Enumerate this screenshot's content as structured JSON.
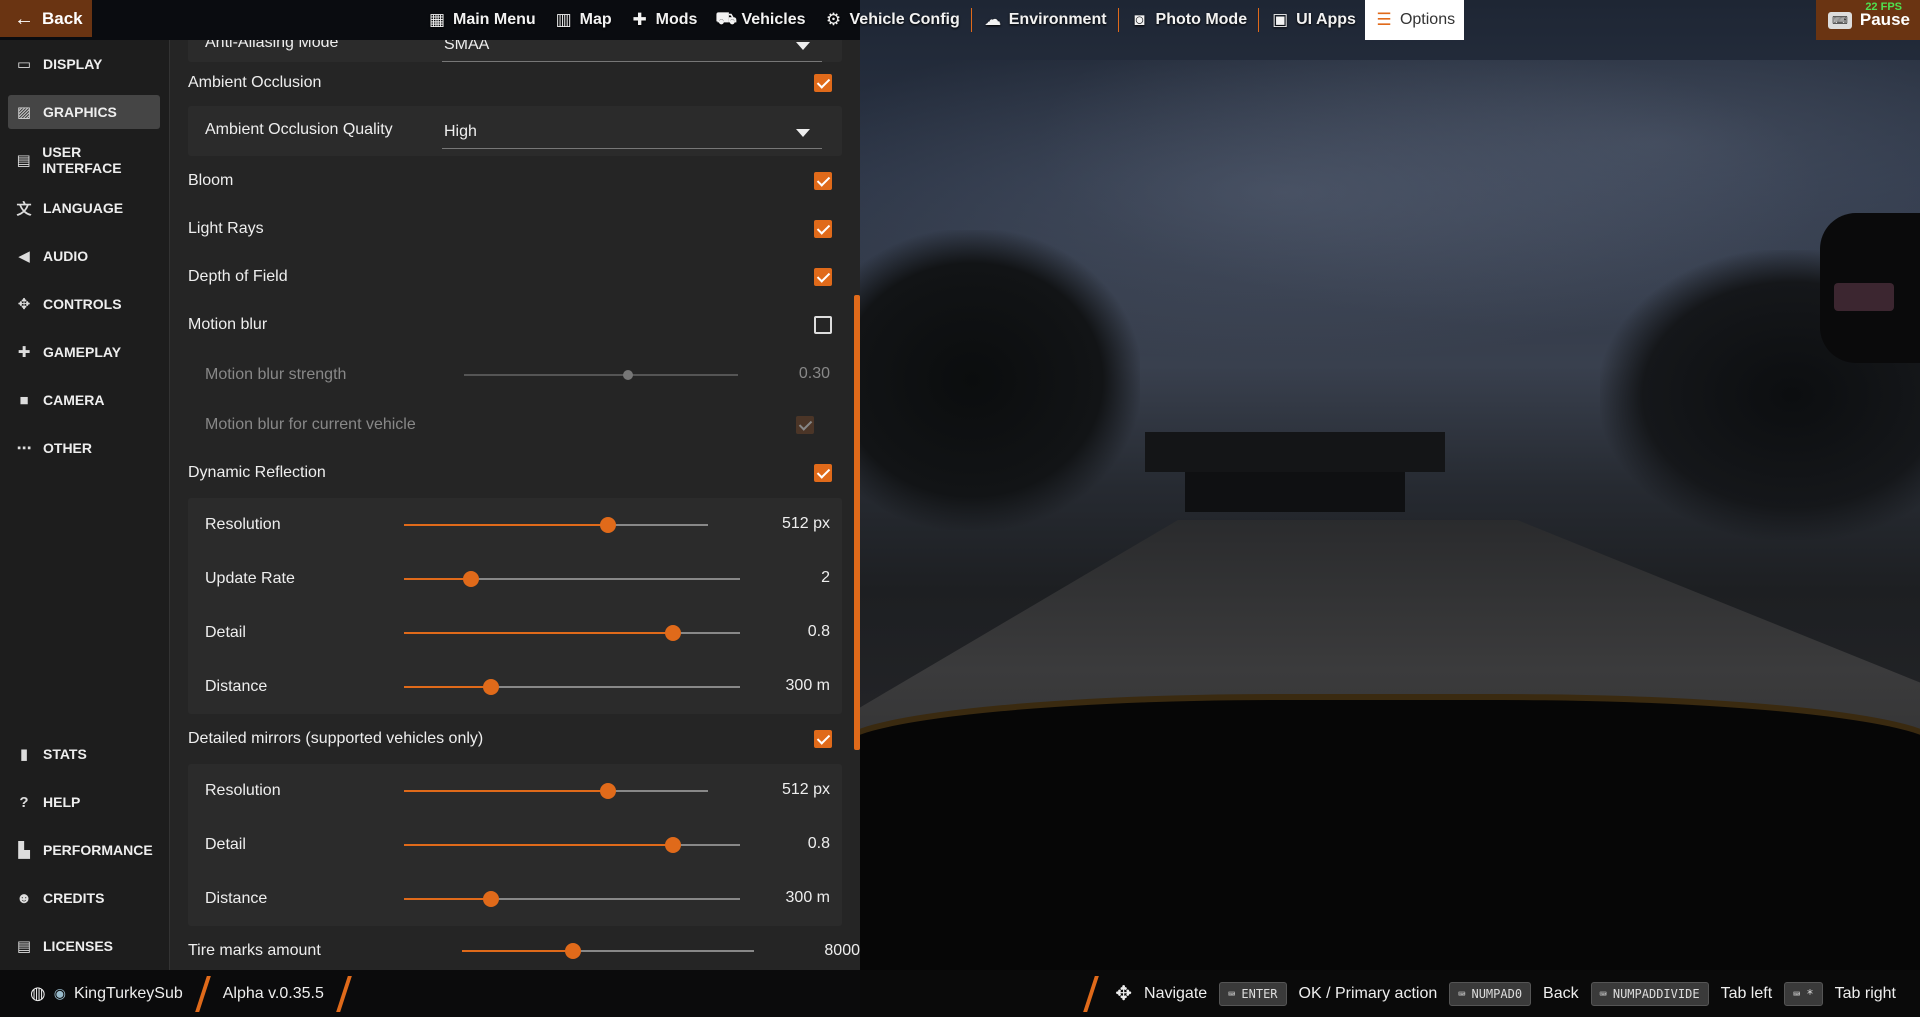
{
  "topbar": {
    "back_label": "Back",
    "nav": [
      {
        "label": "Main Menu",
        "icon": "grid-icon"
      },
      {
        "label": "Map",
        "icon": "map-icon"
      },
      {
        "label": "Mods",
        "icon": "puzzle-icon"
      },
      {
        "label": "Vehicles",
        "icon": "car-icon"
      },
      {
        "label": "Vehicle Config",
        "icon": "car-config-icon"
      },
      {
        "label": "Environment",
        "icon": "weather-icon"
      },
      {
        "label": "Photo Mode",
        "icon": "camera-icon"
      },
      {
        "label": "UI Apps",
        "icon": "apps-icon"
      },
      {
        "label": "Options",
        "icon": "sliders-icon",
        "active": true
      }
    ],
    "pause_label": "Pause",
    "fps": "22 FPS"
  },
  "sidebar": {
    "items": [
      {
        "label": "DISPLAY",
        "icon": "monitor-icon"
      },
      {
        "label": "GRAPHICS",
        "icon": "image-icon",
        "active": true
      },
      {
        "label": "USER INTERFACE",
        "icon": "ui-icon"
      },
      {
        "label": "LANGUAGE",
        "icon": "translate-icon"
      },
      {
        "label": "AUDIO",
        "icon": "speaker-icon"
      },
      {
        "label": "CONTROLS",
        "icon": "gamepad-icon"
      },
      {
        "label": "GAMEPLAY",
        "icon": "puzzle-icon"
      },
      {
        "label": "CAMERA",
        "icon": "video-camera-icon"
      },
      {
        "label": "OTHER",
        "icon": "more-icon"
      }
    ],
    "bottom_items": [
      {
        "label": "STATS",
        "icon": "bar-chart-icon"
      },
      {
        "label": "HELP",
        "icon": "help-icon"
      },
      {
        "label": "PERFORMANCE",
        "icon": "performance-icon"
      },
      {
        "label": "CREDITS",
        "icon": "people-icon"
      },
      {
        "label": "LICENSES",
        "icon": "license-icon"
      }
    ]
  },
  "settings": {
    "antialiasing": {
      "label": "Anti-Aliasing Mode",
      "value": "SMAA"
    },
    "ambient_occlusion": {
      "label": "Ambient Occlusion",
      "checked": true
    },
    "ao_quality": {
      "label": "Ambient Occlusion Quality",
      "value": "High"
    },
    "bloom": {
      "label": "Bloom",
      "checked": true
    },
    "light_rays": {
      "label": "Light Rays",
      "checked": true
    },
    "depth_of_field": {
      "label": "Depth of Field",
      "checked": true
    },
    "motion_blur": {
      "label": "Motion blur",
      "checked": false
    },
    "motion_blur_strength": {
      "label": "Motion blur strength",
      "value": "0.30",
      "fraction": 0.6
    },
    "motion_blur_vehicle": {
      "label": "Motion blur for current vehicle",
      "checked": true
    },
    "dynamic_reflection": {
      "label": "Dynamic Reflection",
      "checked": true
    },
    "dr_resolution": {
      "label": "Resolution",
      "value": "512 px",
      "fraction": 0.67
    },
    "dr_update_rate": {
      "label": "Update Rate",
      "value": "2",
      "fraction": 0.2
    },
    "dr_detail": {
      "label": "Detail",
      "value": "0.8",
      "fraction": 0.8
    },
    "dr_distance": {
      "label": "Distance",
      "value": "300 m",
      "fraction": 0.26
    },
    "detailed_mirrors": {
      "label": "Detailed mirrors (supported vehicles only)",
      "checked": true
    },
    "dm_resolution": {
      "label": "Resolution",
      "value": "512 px",
      "fraction": 0.67
    },
    "dm_detail": {
      "label": "Detail",
      "value": "0.8",
      "fraction": 0.8
    },
    "dm_distance": {
      "label": "Distance",
      "value": "300 m",
      "fraction": 0.26
    },
    "tire_marks": {
      "label": "Tire marks amount",
      "value": "8000",
      "fraction": 0.38
    }
  },
  "bottombar": {
    "user": "KingTurkeySub",
    "version": "Alpha v.0.35.5",
    "hints": [
      {
        "key": "",
        "label": "Navigate",
        "icon": "dpad-icon"
      },
      {
        "key": "ENTER",
        "label": "OK / Primary action"
      },
      {
        "key": "NUMPAD0",
        "label": "Back"
      },
      {
        "key": "NUMPADDIVIDE",
        "label": "Tab left"
      },
      {
        "key": "*",
        "label": "Tab right"
      }
    ]
  },
  "colors": {
    "accent": "#e06a1a",
    "panel": "#252525",
    "sidebar": "#1d1d1d"
  }
}
